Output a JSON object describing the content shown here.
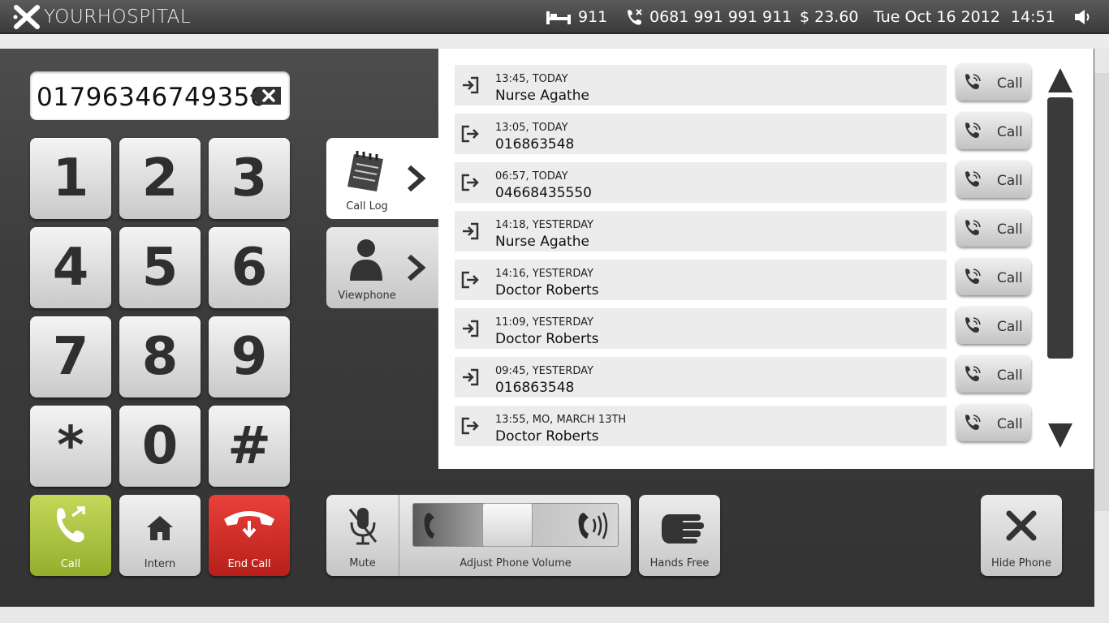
{
  "brand": {
    "name": "YOURHOSPITAL"
  },
  "status": {
    "room": "911",
    "phone": "0681 991 991 911",
    "balance": "$ 23.60",
    "date": "Tue Oct 16 2012",
    "time": "14:51"
  },
  "dialer": {
    "number": "01796346749356",
    "keys": [
      "1",
      "2",
      "3",
      "4",
      "5",
      "6",
      "7",
      "8",
      "9",
      "*",
      "0",
      "#"
    ],
    "call_label": "Call",
    "intern_label": "Intern",
    "end_label": "End Call"
  },
  "tabs": {
    "call_log": "Call Log",
    "viewphone": "Viewphone"
  },
  "call_log": [
    {
      "when": "13:45, TODAY",
      "who": "Nurse Agathe",
      "direction": "incoming"
    },
    {
      "when": "13:05, TODAY",
      "who": "016863548",
      "direction": "outgoing"
    },
    {
      "when": "06:57, TODAY",
      "who": "04668435550",
      "direction": "outgoing"
    },
    {
      "when": "14:18, YESTERDAY",
      "who": "Nurse Agathe",
      "direction": "incoming"
    },
    {
      "when": "14:16, YESTERDAY",
      "who": "Doctor Roberts",
      "direction": "outgoing"
    },
    {
      "when": "11:09, YESTERDAY",
      "who": "Doctor Roberts",
      "direction": "incoming"
    },
    {
      "when": "09:45, YESTERDAY",
      "who": "016863548",
      "direction": "incoming"
    },
    {
      "when": "13:55, MO, MARCH 13TH",
      "who": "Doctor Roberts",
      "direction": "outgoing"
    }
  ],
  "call_button_label": "Call",
  "controls": {
    "mute": "Mute",
    "volume": "Adjust Phone Volume",
    "volume_level": 0.45,
    "hands_free": "Hands Free",
    "hide_phone": "Hide Phone"
  }
}
